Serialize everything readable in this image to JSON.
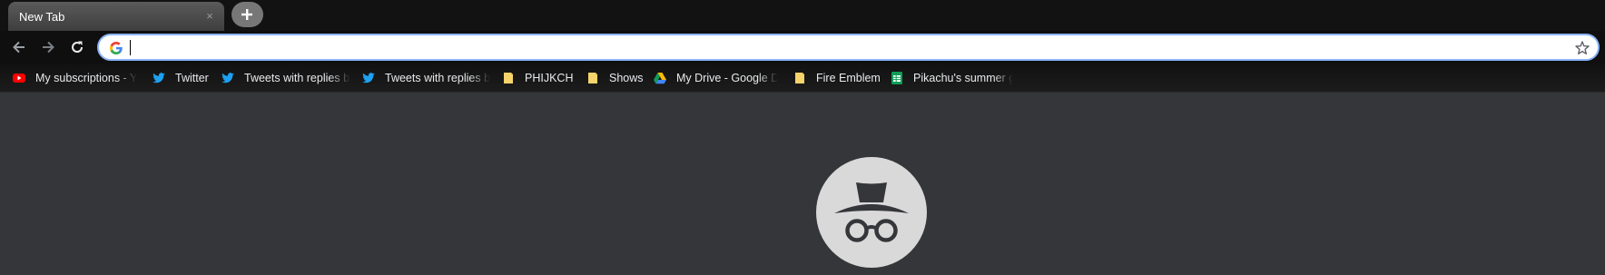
{
  "tab": {
    "title": "New Tab",
    "close_glyph": "×"
  },
  "omnibox": {
    "value": "",
    "placeholder": "",
    "search_engine_icon": "google-g-icon"
  },
  "bookmarks": [
    {
      "label": "My subscriptions - Yo",
      "icon": "youtube-icon"
    },
    {
      "label": "Twitter",
      "icon": "twitter-icon"
    },
    {
      "label": "Tweets with replies by",
      "icon": "twitter-icon"
    },
    {
      "label": "Tweets with replies by",
      "icon": "twitter-icon"
    },
    {
      "label": "PHIJKCHU",
      "icon": "note-icon"
    },
    {
      "label": "Shows",
      "icon": "note-icon"
    },
    {
      "label": "My Drive - Google Dr",
      "icon": "google-drive-icon"
    },
    {
      "label": "Fire Emblem",
      "icon": "note-icon"
    },
    {
      "label": "Pikachu's summer ga",
      "icon": "google-sheets-icon"
    }
  ],
  "colors": {
    "tabstrip": "#121212",
    "toolbar": "#0f0f0f",
    "content": "#35363a",
    "omnibox_border": "#8ab4f8",
    "incognito_circle": "#d9d9d9",
    "incognito_glyph": "#35363a"
  }
}
